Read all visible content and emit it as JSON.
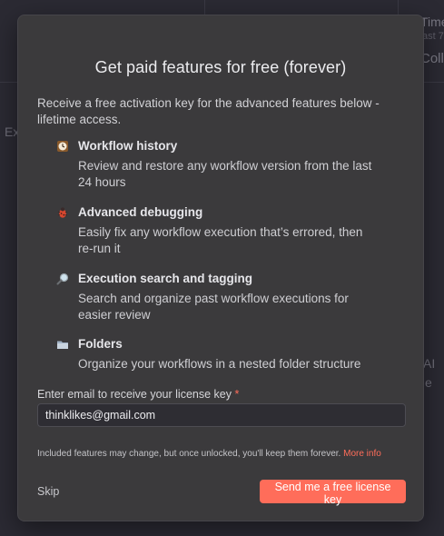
{
  "background": {
    "texts": [
      "Time",
      "ast 7",
      "Coll",
      "Ex",
      "AI",
      "e"
    ]
  },
  "modal": {
    "title": "Get paid features for free (forever)",
    "intro": "Receive a free activation key for the advanced features below - lifetime access.",
    "features": [
      {
        "icon": "clock-icon",
        "title": "Workflow history",
        "description": "Review and restore any workflow version from the last 24 hours"
      },
      {
        "icon": "bug-icon",
        "title": "Advanced debugging",
        "description": "Easily fix any workflow execution that’s errored, then re-run it"
      },
      {
        "icon": "magnifier-icon",
        "title": "Execution search and tagging",
        "description": "Search and organize past workflow executions for easier review"
      },
      {
        "icon": "folder-icon",
        "title": "Folders",
        "description": "Organize your workflows in a nested folder structure"
      }
    ],
    "email_label": "Enter email to receive your license key",
    "email_required_mark": "*",
    "email_value": "thinklikes@gmail.com",
    "fineprint": "Included features may change, but once unlocked, you'll keep them forever.",
    "fineprint_link": "More info",
    "skip_label": "Skip",
    "cta_label": "Send me a free license key"
  },
  "colors": {
    "accent": "#ff6d5a",
    "modal_bg": "#3b3a3c",
    "page_bg": "#2b2a33"
  }
}
